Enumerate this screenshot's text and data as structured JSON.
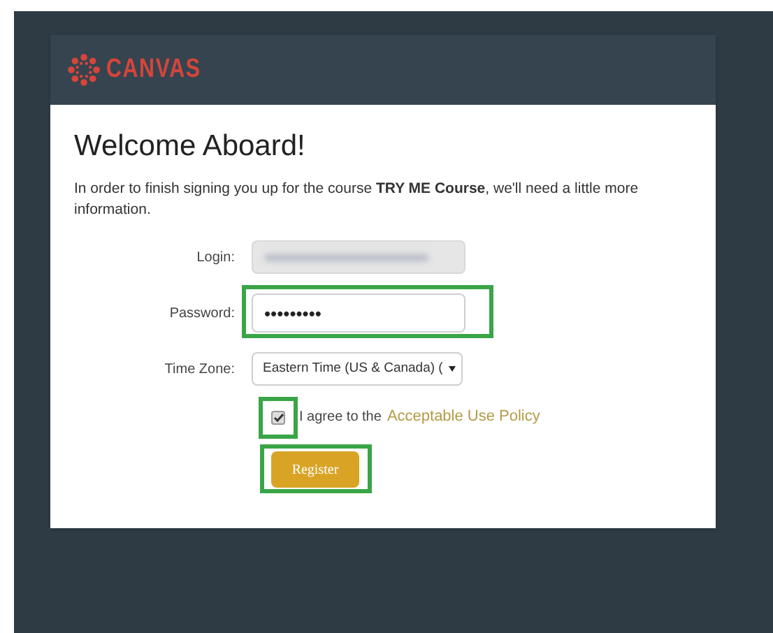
{
  "brand": "CANVAS",
  "heading": "Welcome Aboard!",
  "intro": "In order to finish signing you up for the course **TRY ME Course**, we'll need a little more information.",
  "fields": [
    {
      "kind": "blurred",
      "label": "Login:",
      "highlighted": false
    },
    {
      "kind": "password",
      "label": "Password:",
      "value": "•••••••••",
      "highlighted": true
    },
    {
      "kind": "select",
      "label": "Time Zone:",
      "value": "Eastern Time (US & Canada) (",
      "highlighted": false
    }
  ],
  "agreement": {
    "checked": true,
    "text": "I agree to the",
    "link": "Acceptable Use Policy",
    "highlighted": true
  },
  "register": {
    "label": "Register",
    "highlighted": true
  }
}
